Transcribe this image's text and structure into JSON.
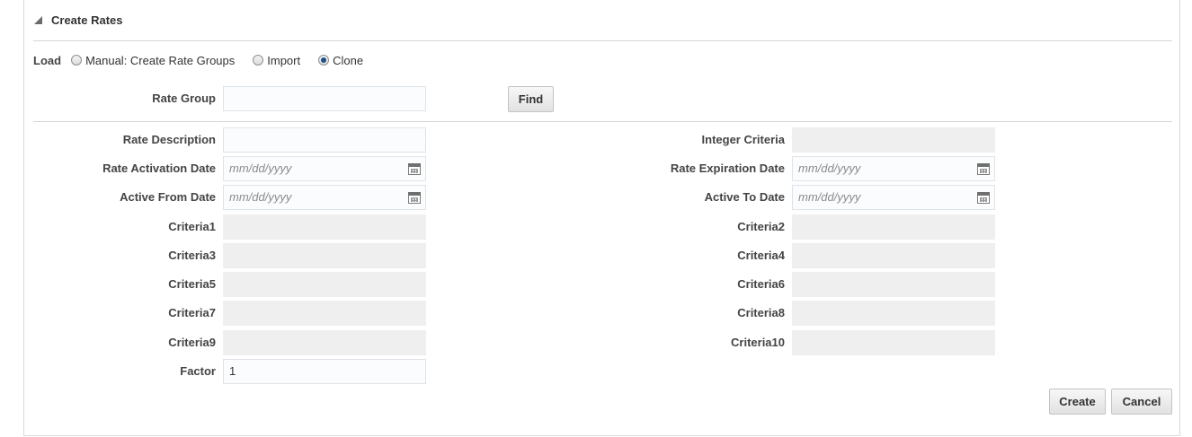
{
  "section": {
    "title": "Create Rates"
  },
  "load": {
    "label": "Load",
    "options": [
      {
        "label": "Manual: Create Rate Groups",
        "selected": false
      },
      {
        "label": "Import",
        "selected": false
      },
      {
        "label": "Clone",
        "selected": true
      }
    ]
  },
  "rate_group": {
    "label": "Rate Group",
    "value": ""
  },
  "find_button": "Find",
  "left_fields": {
    "rate_description": {
      "label": "Rate Description",
      "value": ""
    },
    "rate_activation_date": {
      "label": "Rate Activation Date",
      "placeholder": "mm/dd/yyyy"
    },
    "active_from_date": {
      "label": "Active From Date",
      "placeholder": "mm/dd/yyyy"
    },
    "criteria1": {
      "label": "Criteria1",
      "value": ""
    },
    "criteria3": {
      "label": "Criteria3",
      "value": ""
    },
    "criteria5": {
      "label": "Criteria5",
      "value": ""
    },
    "criteria7": {
      "label": "Criteria7",
      "value": ""
    },
    "criteria9": {
      "label": "Criteria9",
      "value": ""
    },
    "factor": {
      "label": "Factor",
      "value": "1"
    }
  },
  "right_fields": {
    "integer_criteria": {
      "label": "Integer Criteria",
      "value": ""
    },
    "rate_expiration_date": {
      "label": "Rate Expiration Date",
      "placeholder": "mm/dd/yyyy"
    },
    "active_to_date": {
      "label": "Active To Date",
      "placeholder": "mm/dd/yyyy"
    },
    "criteria2": {
      "label": "Criteria2",
      "value": ""
    },
    "criteria4": {
      "label": "Criteria4",
      "value": ""
    },
    "criteria6": {
      "label": "Criteria6",
      "value": ""
    },
    "criteria8": {
      "label": "Criteria8",
      "value": ""
    },
    "criteria10": {
      "label": "Criteria10",
      "value": ""
    }
  },
  "actions": {
    "create": "Create",
    "cancel": "Cancel"
  }
}
